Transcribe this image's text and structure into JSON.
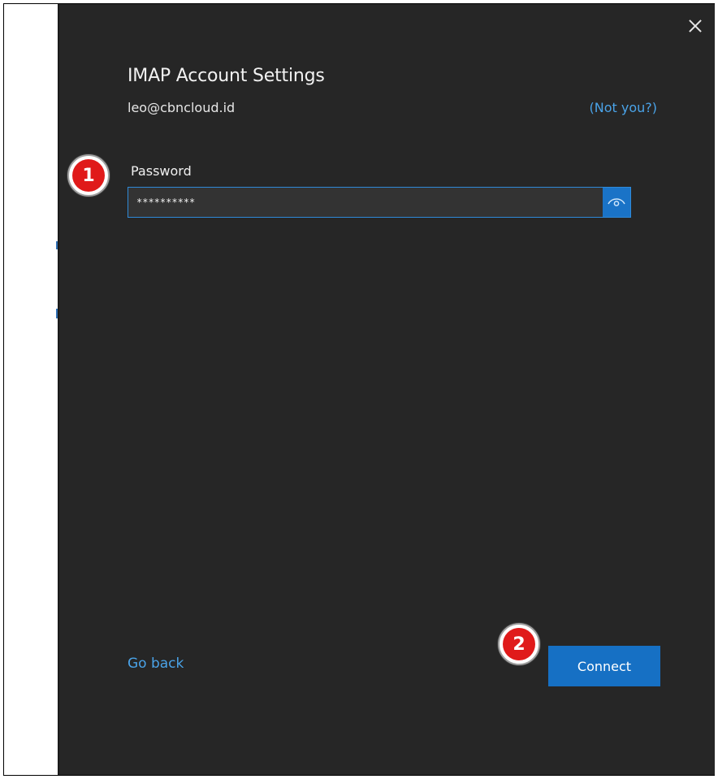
{
  "dialog": {
    "title": "IMAP Account Settings",
    "email": "leo@cbncloud.id",
    "not_you_label": "(Not you?)",
    "password": {
      "label": "Password",
      "value": "**********"
    },
    "go_back_label": "Go back",
    "connect_label": "Connect"
  },
  "annotations": {
    "step1": "1",
    "step2": "2"
  },
  "icons": {
    "close": "close-icon",
    "eye": "eye-icon"
  },
  "colors": {
    "dialog_bg": "#262626",
    "accent": "#1670c4",
    "link": "#4aa3e8",
    "badge": "#e01a1a"
  }
}
